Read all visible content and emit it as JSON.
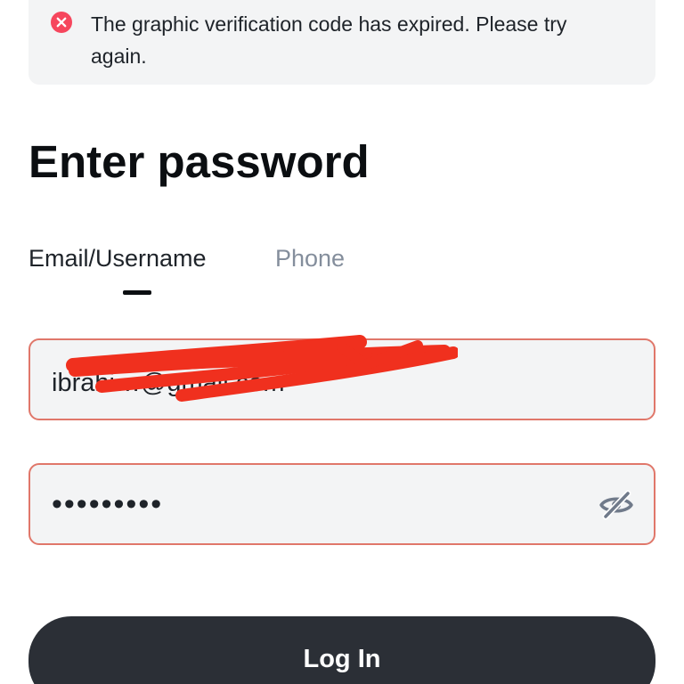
{
  "alert": {
    "icon": "error-circle-icon",
    "message": "The graphic verification code has expired. Please try again.",
    "icon_color": "#f6465d"
  },
  "title": "Enter password",
  "tabs": [
    {
      "label": "Email/Username",
      "active": true
    },
    {
      "label": "Phone",
      "active": false
    }
  ],
  "email_field": {
    "value": "ibrahi…@gmail.com",
    "redacted": true
  },
  "password_field": {
    "value": "•••••••••",
    "toggle_icon": "eye-off-icon"
  },
  "login_button": {
    "label": "Log In"
  },
  "colors": {
    "error_border": "#e0776a",
    "field_background": "#f3f4f5",
    "button_background": "#2b2f36",
    "inactive_tab": "#848e9c",
    "redaction_mark": "#f0301e"
  }
}
